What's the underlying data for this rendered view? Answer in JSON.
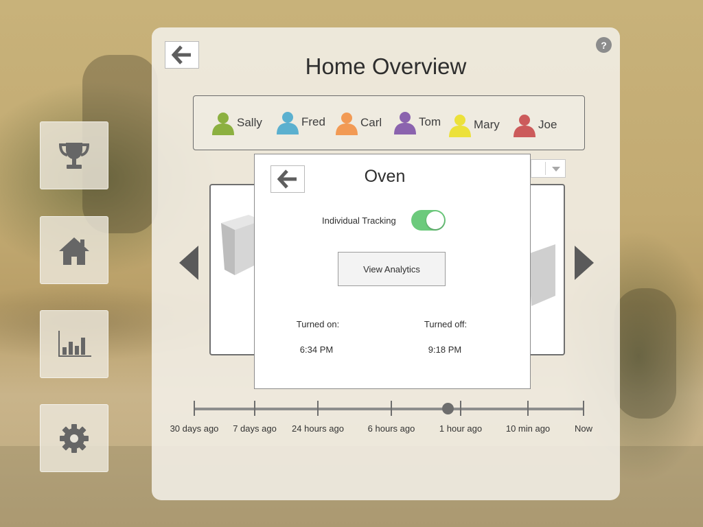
{
  "app": {
    "title": "Home Overview",
    "help_label": "?"
  },
  "nav": [
    {
      "icon": "trophy-icon"
    },
    {
      "icon": "home-icon"
    },
    {
      "icon": "bar-chart-icon"
    },
    {
      "icon": "gear-icon"
    }
  ],
  "users": [
    {
      "name": "Sally",
      "color": "#8cb040"
    },
    {
      "name": "Fred",
      "color": "#5bb0cf"
    },
    {
      "name": "Carl",
      "color": "#f29a54"
    },
    {
      "name": "Tom",
      "color": "#8b63ae"
    },
    {
      "name": "Mary",
      "color": "#ece13a"
    },
    {
      "name": "Joe",
      "color": "#cc5b5b"
    }
  ],
  "timeline": {
    "labels": [
      "30 days ago",
      "7 days ago",
      "24 hours ago",
      "6 hours ago",
      "1 hour ago",
      "10 min ago",
      "Now"
    ],
    "selected": "1 hour ago"
  },
  "modal": {
    "title": "Oven",
    "tracking_label": "Individual Tracking",
    "tracking_on": true,
    "analytics_label": "View Analytics",
    "turned_on_label": "Turned on:",
    "turned_on_value": "6:34 PM",
    "turned_off_label": "Turned off:",
    "turned_off_value": "9:18 PM"
  },
  "colors": {
    "toggle_on": "#6cca7c",
    "icon_gray": "#666666"
  }
}
